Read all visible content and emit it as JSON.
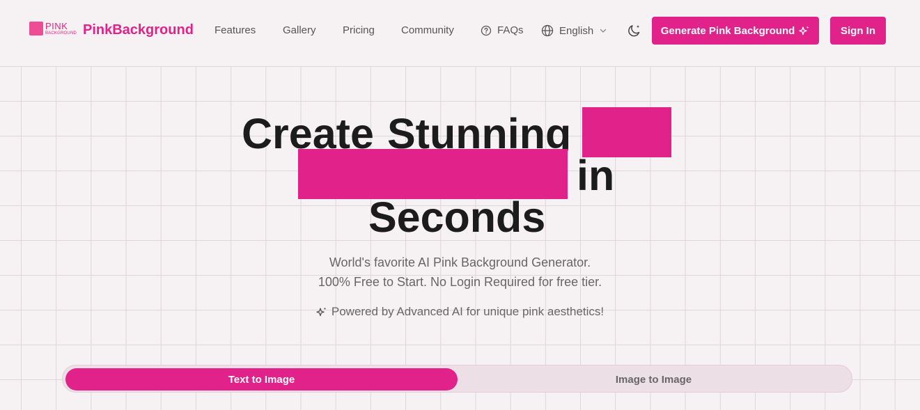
{
  "logo": {
    "line1": "PINK",
    "line2": "BACKGROUND"
  },
  "brand": "PinkBackground",
  "nav": {
    "features": "Features",
    "gallery": "Gallery",
    "pricing": "Pricing",
    "community": "Community",
    "faqs": "FAQs",
    "language": "English",
    "generate_button": "Generate Pink Background",
    "sign_in": "Sign In"
  },
  "hero": {
    "line1_word1": "Create",
    "line1_word2": "Stunning",
    "line2_word": "in",
    "line3_word": "Seconds"
  },
  "subtitle": {
    "line1": "World's favorite AI Pink Background Generator.",
    "line2": "100% Free to Start. No Login Required for free tier."
  },
  "powered": "Powered by Advanced AI for unique pink aesthetics!",
  "tabs": {
    "text_to_image": "Text to Image",
    "image_to_image": "Image to Image"
  },
  "colors": {
    "accent": "#e0228a",
    "background": "#f6f1f3"
  }
}
